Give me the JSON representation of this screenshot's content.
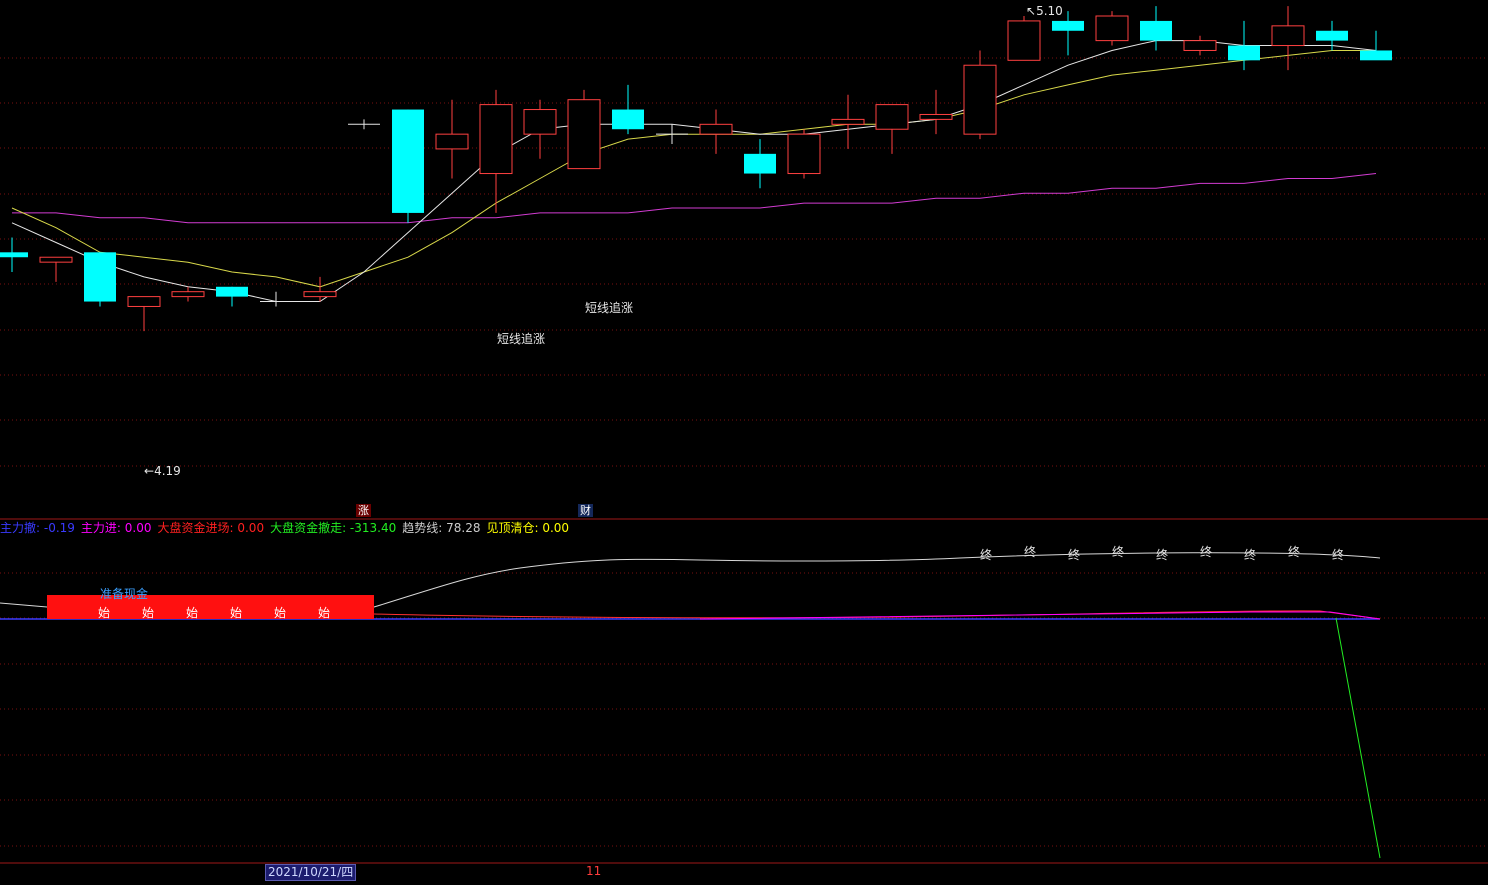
{
  "chart_data": {
    "type": "candlestick",
    "price_panel": {
      "high_marker": "5.10",
      "low_marker": "4.19",
      "candles": [
        {
          "o": 4.62,
          "h": 4.65,
          "l": 4.58,
          "c": 4.61
        },
        {
          "o": 4.6,
          "h": 4.61,
          "l": 4.56,
          "c": 4.61
        },
        {
          "o": 4.62,
          "h": 4.62,
          "l": 4.51,
          "c": 4.52
        },
        {
          "o": 4.51,
          "h": 4.53,
          "l": 4.46,
          "c": 4.53
        },
        {
          "o": 4.53,
          "h": 4.55,
          "l": 4.52,
          "c": 4.54
        },
        {
          "o": 4.55,
          "h": 4.55,
          "l": 4.51,
          "c": 4.53
        },
        {
          "o": 4.52,
          "h": 4.54,
          "l": 4.51,
          "c": 4.52
        },
        {
          "o": 4.53,
          "h": 4.57,
          "l": 4.52,
          "c": 4.54
        },
        {
          "o": 4.88,
          "h": 4.89,
          "l": 4.87,
          "c": 4.88
        },
        {
          "o": 4.91,
          "h": 4.91,
          "l": 4.68,
          "c": 4.7
        },
        {
          "o": 4.83,
          "h": 4.93,
          "l": 4.77,
          "c": 4.86
        },
        {
          "o": 4.78,
          "h": 4.95,
          "l": 4.7,
          "c": 4.92
        },
        {
          "o": 4.86,
          "h": 4.93,
          "l": 4.81,
          "c": 4.91
        },
        {
          "o": 4.79,
          "h": 4.95,
          "l": 4.79,
          "c": 4.93
        },
        {
          "o": 4.91,
          "h": 4.96,
          "l": 4.86,
          "c": 4.87
        },
        {
          "o": 4.86,
          "h": 4.88,
          "l": 4.84,
          "c": 4.86
        },
        {
          "o": 4.86,
          "h": 4.91,
          "l": 4.82,
          "c": 4.88
        },
        {
          "o": 4.82,
          "h": 4.85,
          "l": 4.75,
          "c": 4.78
        },
        {
          "o": 4.78,
          "h": 4.87,
          "l": 4.77,
          "c": 4.86
        },
        {
          "o": 4.88,
          "h": 4.94,
          "l": 4.83,
          "c": 4.89
        },
        {
          "o": 4.87,
          "h": 4.91,
          "l": 4.82,
          "c": 4.92
        },
        {
          "o": 4.89,
          "h": 4.95,
          "l": 4.86,
          "c": 4.9
        },
        {
          "o": 4.86,
          "h": 5.03,
          "l": 4.85,
          "c": 5.0
        },
        {
          "o": 5.01,
          "h": 5.1,
          "l": 5.01,
          "c": 5.09
        },
        {
          "o": 5.09,
          "h": 5.11,
          "l": 5.02,
          "c": 5.07
        },
        {
          "o": 5.05,
          "h": 5.11,
          "l": 5.04,
          "c": 5.1
        },
        {
          "o": 5.09,
          "h": 5.12,
          "l": 5.03,
          "c": 5.05
        },
        {
          "o": 5.03,
          "h": 5.06,
          "l": 5.02,
          "c": 5.05
        },
        {
          "o": 5.04,
          "h": 5.09,
          "l": 4.99,
          "c": 5.01
        },
        {
          "o": 5.04,
          "h": 5.12,
          "l": 4.99,
          "c": 5.08
        },
        {
          "o": 5.07,
          "h": 5.09,
          "l": 5.03,
          "c": 5.05
        },
        {
          "o": 5.03,
          "h": 5.07,
          "l": 5.02,
          "c": 5.01
        }
      ],
      "ma_white": [
        4.68,
        4.64,
        4.6,
        4.57,
        4.55,
        4.54,
        4.52,
        4.52,
        4.58,
        4.66,
        4.74,
        4.82,
        4.87,
        4.88,
        4.88,
        4.88,
        4.87,
        4.86,
        4.86,
        4.87,
        4.88,
        4.89,
        4.92,
        4.96,
        5.0,
        5.03,
        5.05,
        5.05,
        5.04,
        5.04,
        5.04,
        5.03
      ],
      "ma_yellow": [
        4.71,
        4.67,
        4.62,
        4.61,
        4.6,
        4.58,
        4.57,
        4.55,
        4.58,
        4.61,
        4.66,
        4.72,
        4.77,
        4.82,
        4.85,
        4.86,
        4.86,
        4.86,
        4.87,
        4.88,
        4.88,
        4.89,
        4.91,
        4.94,
        4.96,
        4.98,
        4.99,
        5.0,
        5.01,
        5.02,
        5.03,
        5.03
      ],
      "ma_magenta": [
        4.7,
        4.7,
        4.69,
        4.69,
        4.68,
        4.68,
        4.68,
        4.68,
        4.68,
        4.68,
        4.69,
        4.69,
        4.7,
        4.7,
        4.7,
        4.71,
        4.71,
        4.71,
        4.72,
        4.72,
        4.72,
        4.73,
        4.73,
        4.74,
        4.74,
        4.75,
        4.75,
        4.76,
        4.76,
        4.77,
        4.77,
        4.78
      ],
      "signals": [
        "短线追涨",
        "短线追涨"
      ]
    },
    "indicator_panel": {
      "legend": [
        {
          "label": "主力撤:",
          "value": "-0.19",
          "color": "#3a3aff"
        },
        {
          "label": "主力进:",
          "value": "0.00",
          "color": "#ff00ff"
        },
        {
          "label": "大盘资金进场:",
          "value": "0.00",
          "color": "#ff2020"
        },
        {
          "label": "大盘资金撤走:",
          "value": "-313.40",
          "color": "#22ee22"
        },
        {
          "label": "趋势线:",
          "value": "78.28",
          "color": "#cccccc"
        },
        {
          "label": "见顶清仓:",
          "value": "0.00",
          "color": "#ffff00"
        }
      ],
      "start_mark": "始",
      "end_mark": "终",
      "prepare_label": "准备现金"
    },
    "x_axis": {
      "date_label": "2021/10/21/四",
      "month_label": "11"
    },
    "tags": {
      "zhang": "涨",
      "cai": "财"
    }
  }
}
